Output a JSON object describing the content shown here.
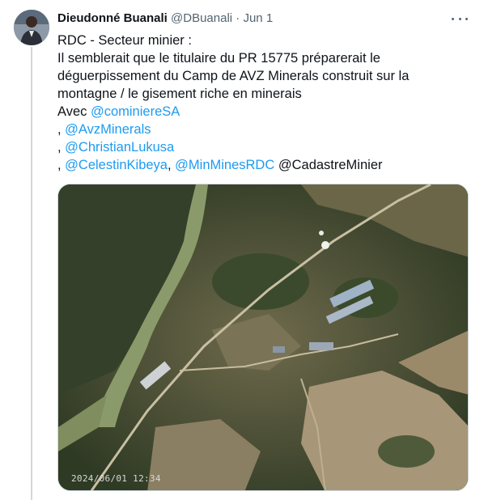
{
  "tweet": {
    "author_name": "Dieudonné Buanali",
    "author_handle": "@DBuanali",
    "separator": "·",
    "date": "Jun 1",
    "lines": {
      "l1": "RDC - Secteur minier :",
      "l2": "Il semblerait que le titulaire du PR 15775 préparerait le",
      "l3": "déguerpissement du Camp de AVZ Minerals construit sur la",
      "l4": "montagne / le gisement riche en minerais",
      "l5_prefix": "Avec ",
      "sep": ", ",
      "sep_mid": ", ",
      "space": " "
    },
    "mentions": {
      "cominiere": "@cominiereSA",
      "avz": "@AvzMinerals",
      "lukusa": "@ChristianLukusa",
      "kibeya": "@CelestinKibeya",
      "minmines": "@MinMinesRDC"
    },
    "plain_mention": "@CadastreMinier",
    "media_timestamp": "2024/06/01 12:34"
  },
  "icons": {
    "more": "more-horizontal-icon"
  }
}
